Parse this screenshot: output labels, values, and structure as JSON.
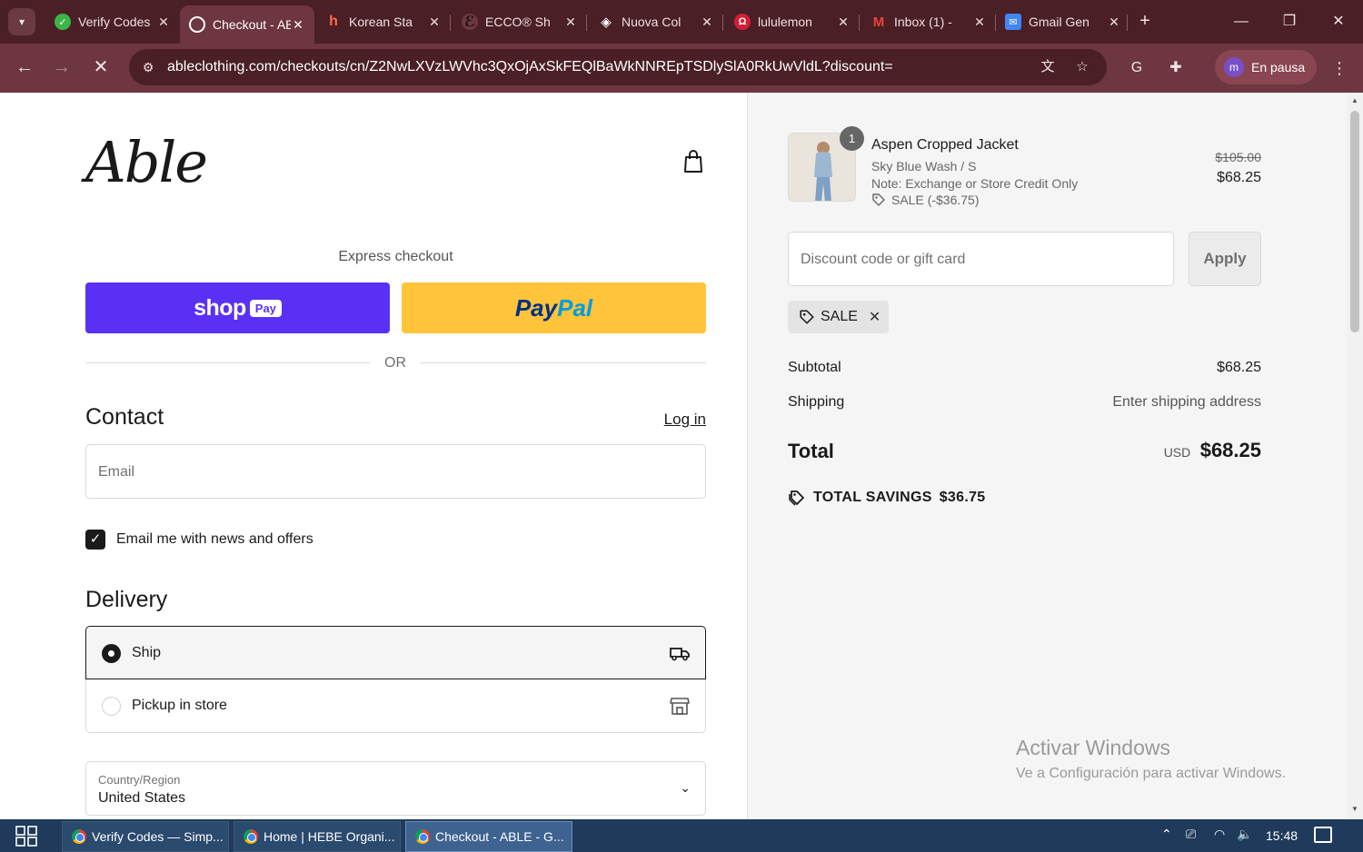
{
  "browser": {
    "tabs": [
      {
        "label": "Verify Codes",
        "icon": "verify-codes-favicon",
        "color": "#3bb54a"
      },
      {
        "label": "Checkout - ABLE",
        "icon": "checkout-favicon",
        "color": "#ffffff"
      },
      {
        "label": "Korean Sta",
        "icon": "korean-favicon",
        "color": "#d83a2a"
      },
      {
        "label": "ECCO® Sh",
        "icon": "ecco-favicon",
        "color": "#222222"
      },
      {
        "label": "Nuova Col",
        "icon": "nuova-favicon",
        "color": "#ffffff"
      },
      {
        "label": "lululemon",
        "icon": "lululemon-favicon",
        "color": "#d31f36"
      },
      {
        "label": "Inbox (1) -",
        "icon": "gmail-favicon",
        "color": "#ea4335"
      },
      {
        "label": "Gmail Gen",
        "icon": "gmail-generator-favicon",
        "color": "#4285f4"
      }
    ],
    "url": "ableclothing.com/checkouts/cn/Z2NwLXVzLWVhc3QxOjAxSkFEQlBaWkNNREpTSDlySlA0RkUwVldL?discount=",
    "profile_label": "En pausa",
    "profile_initial": "m"
  },
  "checkout": {
    "logo": "Able",
    "express_label": "Express checkout",
    "shop_pay": {
      "word": "shop",
      "badge": "Pay"
    },
    "paypal": {
      "part1": "Pay",
      "part2": "Pal"
    },
    "or_label": "OR",
    "contact_title": "Contact",
    "login_label": "Log in",
    "email_placeholder": "Email",
    "news_checkbox_label": "Email me with news and offers",
    "news_checked": true,
    "delivery_title": "Delivery",
    "options": [
      {
        "label": "Ship",
        "selected": true
      },
      {
        "label": "Pickup in store",
        "selected": false
      }
    ],
    "country_label": "Country/Region",
    "country_value": "United States"
  },
  "summary": {
    "quantity": "1",
    "product_name": "Aspen Cropped Jacket",
    "variant": "Sky Blue Wash / S",
    "note": "Note: Exchange or Store Credit Only",
    "sale_line": "SALE (-$36.75)",
    "price_original": "$105.00",
    "price_current": "$68.25",
    "discount_placeholder": "Discount code or gift card",
    "apply_label": "Apply",
    "applied_code": "SALE",
    "subtotal_label": "Subtotal",
    "subtotal_value": "$68.25",
    "shipping_label": "Shipping",
    "shipping_value": "Enter shipping address",
    "total_label": "Total",
    "total_currency": "USD",
    "total_value": "$68.25",
    "savings_label": "TOTAL SAVINGS",
    "savings_value": "$36.75"
  },
  "watermark": {
    "line1": "Activar Windows",
    "line2": "Ve a Configuración para activar Windows."
  },
  "taskbar": {
    "items": [
      {
        "label": "Verify Codes — Simp..."
      },
      {
        "label": "Home | HEBE Organi..."
      },
      {
        "label": "Checkout - ABLE - G..."
      }
    ],
    "time": "15:48"
  }
}
